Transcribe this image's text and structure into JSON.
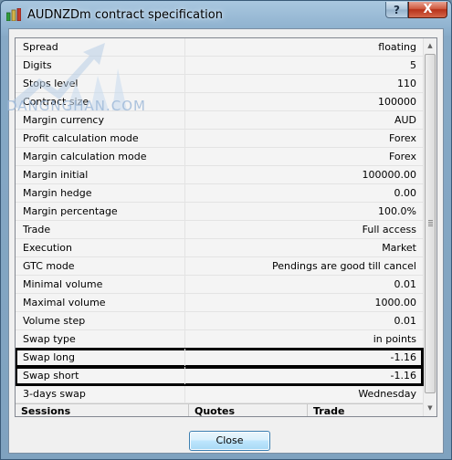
{
  "window": {
    "title": "AUDNZDm contract specification",
    "help_label": "?",
    "close_label": "X"
  },
  "watermark": {
    "text": "DANGNGHAN.COM"
  },
  "spec_rows": [
    {
      "name": "Spread",
      "value": "floating"
    },
    {
      "name": "Digits",
      "value": "5"
    },
    {
      "name": "Stops level",
      "value": "110"
    },
    {
      "name": "Contract size",
      "value": "100000"
    },
    {
      "name": "Margin currency",
      "value": "AUD"
    },
    {
      "name": "Profit calculation mode",
      "value": "Forex"
    },
    {
      "name": "Margin calculation mode",
      "value": "Forex"
    },
    {
      "name": "Margin initial",
      "value": "100000.00"
    },
    {
      "name": "Margin hedge",
      "value": "0.00"
    },
    {
      "name": "Margin percentage",
      "value": "100.0%"
    },
    {
      "name": "Trade",
      "value": "Full access"
    },
    {
      "name": "Execution",
      "value": "Market"
    },
    {
      "name": "GTC mode",
      "value": "Pendings are good till cancel"
    },
    {
      "name": "Minimal volume",
      "value": "0.01"
    },
    {
      "name": "Maximal volume",
      "value": "1000.00"
    },
    {
      "name": "Volume step",
      "value": "0.01"
    },
    {
      "name": "Swap type",
      "value": "in points"
    },
    {
      "name": "Swap long",
      "value": "-1.16"
    },
    {
      "name": "Swap short",
      "value": "-1.16"
    },
    {
      "name": "3-days swap",
      "value": "Wednesday"
    }
  ],
  "sessions_header": {
    "sessions": "Sessions",
    "quotes": "Quotes",
    "trade": "Trade"
  },
  "buttons": {
    "close": "Close"
  }
}
